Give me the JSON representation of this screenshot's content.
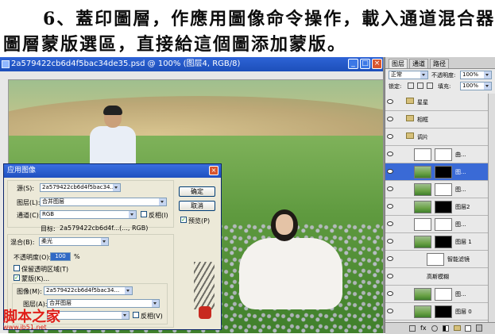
{
  "caption": {
    "line1": "6、蓋印圖層，作應用圖像命令操作，載入通道混合器",
    "line2": "圖層蒙版選區，直接給這個圖添加蒙版。"
  },
  "document": {
    "title": "2a579422cb6d4f5bac34de35.psd @ 100% (图层4, RGB/8)"
  },
  "dialog": {
    "title": "应用图像",
    "source_label": "源(S):",
    "source_value": "2a579422cb6d4f5bac34...",
    "layer_label": "图层(L):",
    "layer_value": "合并图层",
    "channel_label": "通道(C):",
    "channel_value": "RGB",
    "invert1_label": "反相(I)",
    "target_label": "目标:",
    "target_value": "2a579422cb6d4f...(..., RGB)",
    "blend_label": "混合(B):",
    "blend_value": "柔光",
    "opacity_label": "不透明度(O):",
    "opacity_value": "100",
    "opacity_unit": "%",
    "preserve_label": "保留透明区域(T)",
    "mask_label": "蒙版(K)...",
    "image_label": "图像(M):",
    "image_value": "2a579422cb6d4f5bac34...",
    "layer2_label": "图层(A):",
    "layer2_value": "合并图层",
    "invert2_label": "反相(V)",
    "ok_label": "确定",
    "cancel_label": "取消",
    "preview_label": "预览(P)"
  },
  "watermark": {
    "text": "脚本之家",
    "url": "www.jb51.net"
  },
  "panel": {
    "tabs": [
      "图层",
      "通道",
      "路径"
    ],
    "blend_mode": "正常",
    "opacity_label": "不透明度:",
    "opacity_value": "100%",
    "lock_label": "锁定:",
    "fill_label": "填充:",
    "fill_value": "100%",
    "layers": [
      {
        "name": "星星",
        "kind": "folder"
      },
      {
        "name": "相框",
        "kind": "folder"
      },
      {
        "name": "调片",
        "kind": "folder"
      },
      {
        "name": "曲...",
        "kind": "adjust"
      },
      {
        "name": "图...",
        "kind": "photo",
        "selected": true
      },
      {
        "name": "图...",
        "kind": "photo"
      },
      {
        "name": "图层2",
        "kind": "photo"
      },
      {
        "name": "图...",
        "kind": "adjust"
      },
      {
        "name": "图层 1",
        "kind": "photo"
      },
      {
        "name": "智能滤镜",
        "kind": "mask"
      },
      {
        "name": "高斯模糊",
        "kind": "filter"
      },
      {
        "name": "图...",
        "kind": "photo"
      },
      {
        "name": "图层 0",
        "kind": "photo"
      }
    ]
  }
}
